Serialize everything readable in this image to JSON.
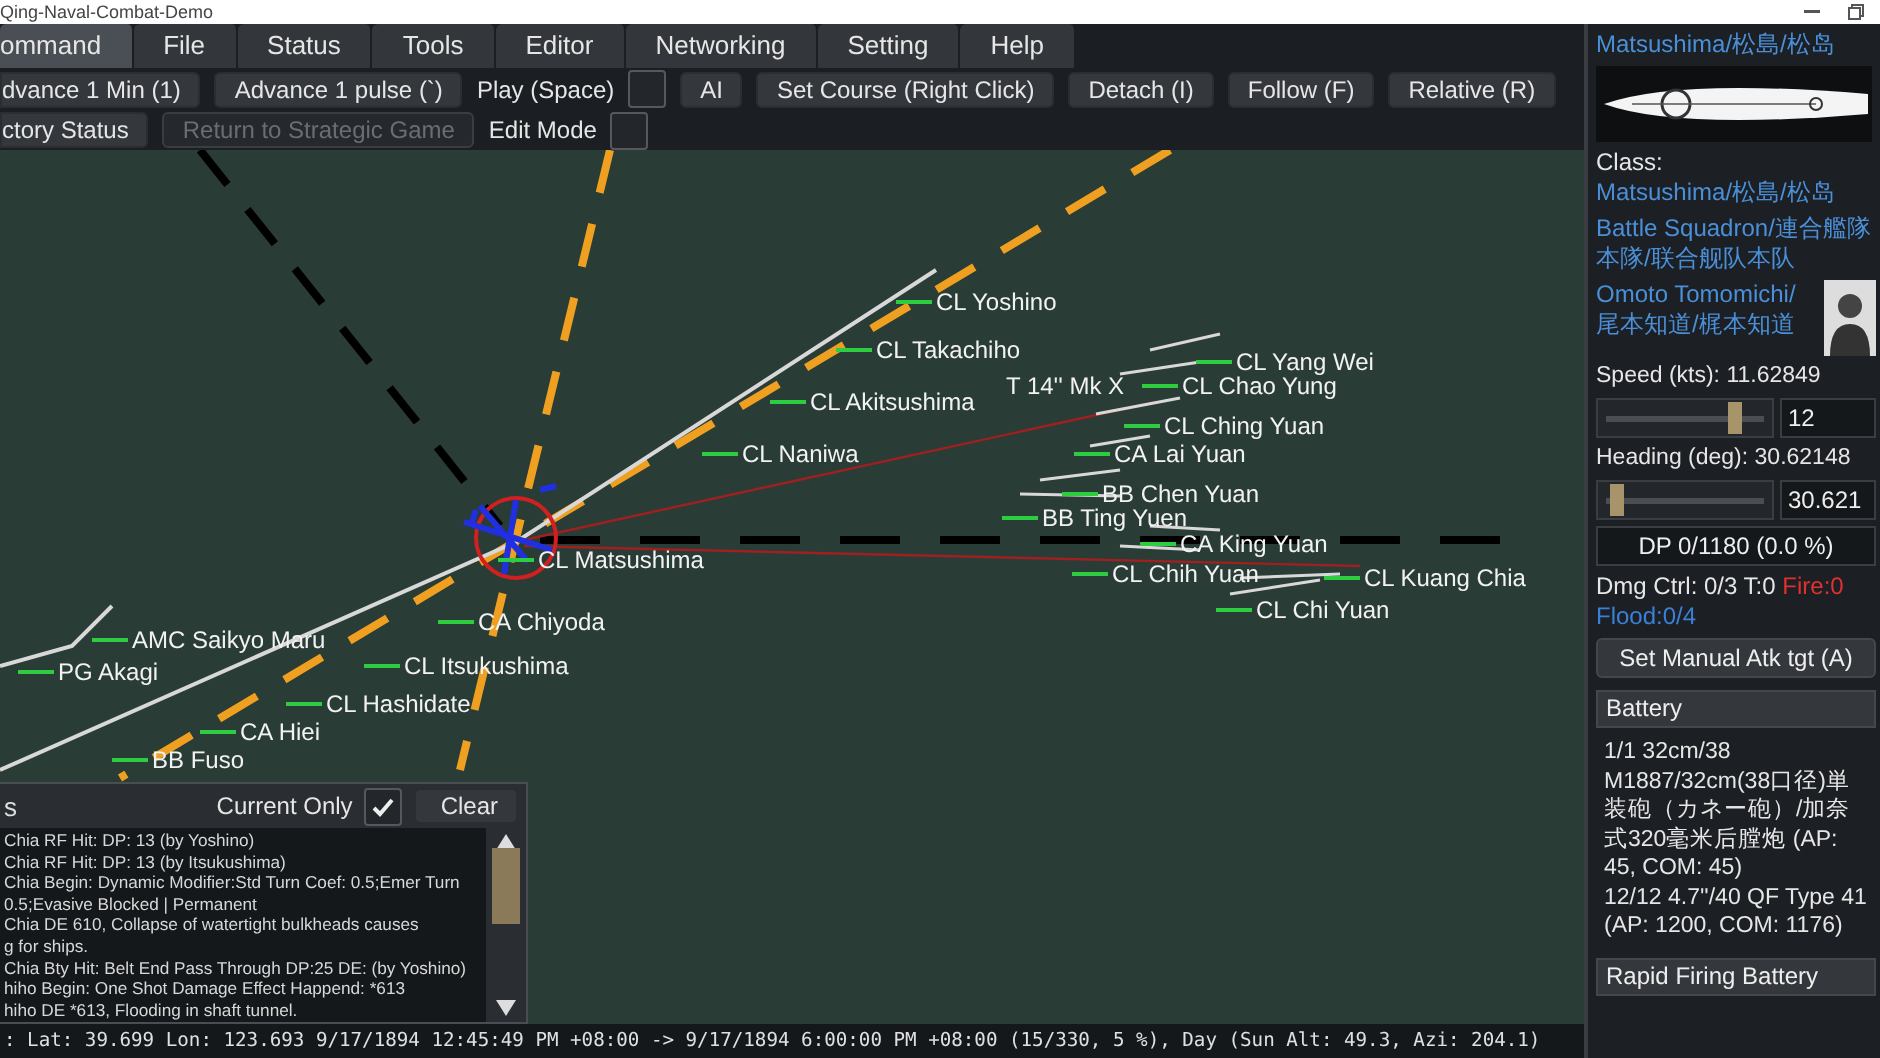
{
  "window": {
    "title": "Qing-Naval-Combat-Demo"
  },
  "menu_tabs": [
    {
      "label": "ommand",
      "selected": true
    },
    {
      "label": "File",
      "selected": false
    },
    {
      "label": "Status",
      "selected": false
    },
    {
      "label": "Tools",
      "selected": false
    },
    {
      "label": "Editor",
      "selected": false
    },
    {
      "label": "Networking",
      "selected": false
    },
    {
      "label": "Setting",
      "selected": false
    },
    {
      "label": "Help",
      "selected": false
    }
  ],
  "toolbar_rows": [
    [
      {
        "kind": "button",
        "label": "dvance 1 Min (1)",
        "disabled": false
      },
      {
        "kind": "button",
        "label": "Advance 1 pulse (`)",
        "disabled": false
      },
      {
        "kind": "checkbox",
        "label": "Play (Space)",
        "checked": false
      },
      {
        "kind": "button",
        "label": "AI",
        "disabled": false
      },
      {
        "kind": "button",
        "label": "Set Course (Right Click)",
        "disabled": false
      },
      {
        "kind": "button",
        "label": "Detach (I)",
        "disabled": false
      },
      {
        "kind": "button",
        "label": "Follow (F)",
        "disabled": false
      },
      {
        "kind": "button",
        "label": "Relative (R)",
        "disabled": false
      }
    ],
    [
      {
        "kind": "button",
        "label": "ctory Status",
        "disabled": false
      },
      {
        "kind": "button",
        "label": "Return to Strategic Game",
        "disabled": true
      },
      {
        "kind": "checkbox",
        "label": "Edit Mode",
        "checked": false
      }
    ]
  ],
  "map": {
    "units": [
      {
        "kind": "ship",
        "label": "CL Yoshino"
      },
      {
        "kind": "ship",
        "label": "CL Takachiho"
      },
      {
        "kind": "ship",
        "label": "CL Akitsushima"
      },
      {
        "kind": "ship",
        "label": "CL Naniwa"
      },
      {
        "kind": "ship",
        "label": "CL Matsushima"
      },
      {
        "kind": "ship",
        "label": "CA Chiyoda"
      },
      {
        "kind": "ship",
        "label": "CL Itsukushima"
      },
      {
        "kind": "ship",
        "label": "CL Hashidate"
      },
      {
        "kind": "ship",
        "label": "CA Hiei"
      },
      {
        "kind": "ship",
        "label": "BB Fuso"
      },
      {
        "kind": "ship",
        "label": "AMC Saikyo Maru"
      },
      {
        "kind": "ship",
        "label": "PG Akagi"
      },
      {
        "kind": "ship",
        "label": "CL Yang Wei"
      },
      {
        "kind": "torpedo",
        "label": "T 14'' Mk X"
      },
      {
        "kind": "ship",
        "label": "CL Chao Yung"
      },
      {
        "kind": "ship",
        "label": "CL Ching Yuan"
      },
      {
        "kind": "ship",
        "label": "CA Lai Yuan"
      },
      {
        "kind": "ship",
        "label": "BB Chen Yuan"
      },
      {
        "kind": "ship",
        "label": "BB Ting Yuen"
      },
      {
        "kind": "ship",
        "label": "CA King Yuan"
      },
      {
        "kind": "ship",
        "label": "CL Chih Yuan"
      },
      {
        "kind": "ship",
        "label": "CL Kuang Chia"
      },
      {
        "kind": "ship",
        "label": "CL Chi Yuan"
      }
    ]
  },
  "log_panel": {
    "title": "s",
    "filter": {
      "label": "Current Only",
      "checked": true
    },
    "clear_button": "Clear",
    "entries": [
      "Chia RF Hit: DP: 13 (by Yoshino)",
      "Chia RF Hit: DP: 13 (by Itsukushima)",
      "Chia Begin: Dynamic Modifier:Std Turn Coef: 0.5;Emer Turn",
      "0.5;Evasive Blocked | Permanent",
      "Chia DE 610, Collapse of watertight bulkheads causes",
      "g for ships.",
      "Chia Bty Hit: Belt End Pass Through DP:25 DE: (by Yoshino)",
      "hiho Begin: One Shot Damage Effect Happend: *613",
      "hiho DE *613, Flooding in shaft tunnel."
    ]
  },
  "status_bar": ": Lat: 39.699 Lon: 123.693 9/17/1894 12:45:49 PM +08:00 -> 9/17/1894 6:00:00 PM +08:00 (15/330, 5 %), Day (Sun Alt: 49.3, Azi: 204.1)",
  "ship_panel": {
    "name": "Matsushima/松島/松岛",
    "class_label": "Class:",
    "class_value": "Matsushima/松島/松岛",
    "unit": "Battle Squadron/連合艦隊本隊/联合舰队本队",
    "commander": "Omoto Tomomichi/尾本知道/梶本知道",
    "speed": {
      "label": "Speed (kts):",
      "reading": "11.62849",
      "level": 0.78,
      "value": "12"
    },
    "heading": {
      "label": "Heading (deg):",
      "reading": "30.62148",
      "level": 0.1,
      "value": "30.621"
    },
    "dp": "DP 0/1180 (0.0 %)",
    "damage_control": {
      "text": "Dmg Ctrl: 0/3 T:0",
      "fire": "Fire:0",
      "flood": "Flood:0/4"
    },
    "attack_button": "Set Manual Atk tgt (A)",
    "sections": [
      {
        "title": "Battery",
        "lines": [
          "1/1 32cm/38 M1887/32cm(38口径)単装砲（カネー砲）/加奈式320毫米后膛炮 (AP: 45, COM: 45)",
          "12/12 4.7''/40 QF Type 41 (AP: 1200, COM: 1176)"
        ]
      },
      {
        "title": "Rapid Firing Battery"
      }
    ]
  }
}
